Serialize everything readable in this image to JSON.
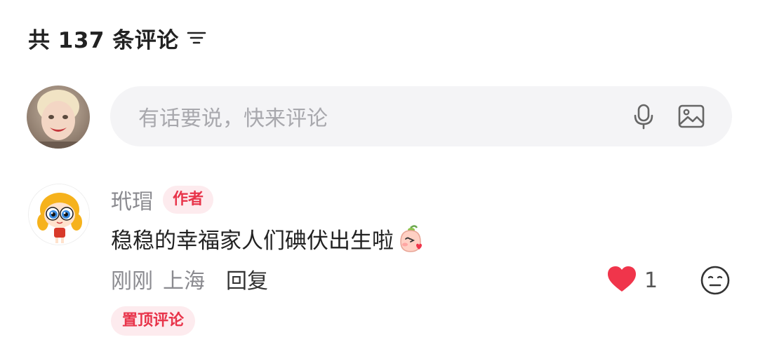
{
  "header": {
    "title": "共 137 条评论",
    "sort_icon": "sort-lines-icon"
  },
  "composer": {
    "placeholder": "有话要说，快来评论",
    "icons": [
      "microphone-icon",
      "image-icon"
    ]
  },
  "comment": {
    "username": "玳瑁",
    "author_badge": "作者",
    "text": "稳稳的幸福家人们碘伏出生啦",
    "emoji": "kiss-peach-emoji",
    "time": "刚刚",
    "location": "上海",
    "reply_label": "回复",
    "likes": "1",
    "like_color": "#f0354b",
    "pinned_label": "置顶评论"
  },
  "colors": {
    "accent": "#e8344a",
    "badge_bg": "#fdebee",
    "input_bg": "#f4f4f6"
  }
}
